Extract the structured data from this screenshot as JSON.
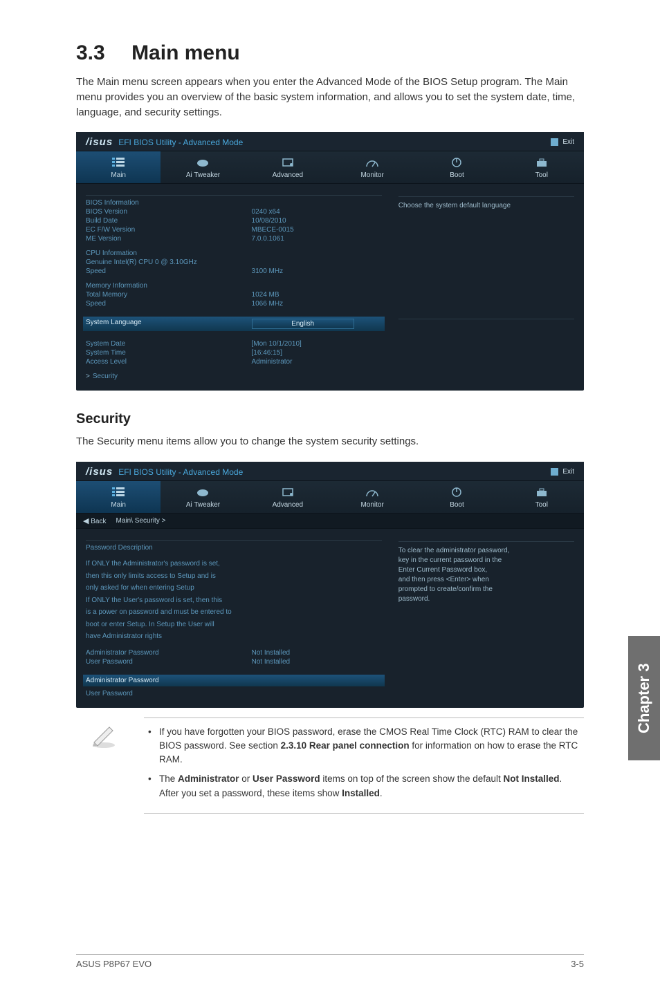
{
  "section": {
    "number": "3.3",
    "title": "Main menu"
  },
  "intro": "The Main menu screen appears when you enter the Advanced Mode of the BIOS Setup program. The Main menu provides you an overview of the basic system information, and allows you to set the system date, time, language, and security settings.",
  "bios_common": {
    "logo": "/isus",
    "utility_title": "EFI BIOS Utility - Advanced Mode",
    "exit_label": "Exit",
    "tabs": {
      "main": "Main",
      "ai_tweaker": "Ai Tweaker",
      "advanced": "Advanced",
      "monitor": "Monitor",
      "boot": "Boot",
      "tool": "Tool"
    }
  },
  "bios_main": {
    "help_text": "Choose the system default language",
    "rows": {
      "bios_information": "BIOS Information",
      "bios_version_k": "BIOS Version",
      "bios_version_v": "0240 x64",
      "build_date_k": "Build Date",
      "build_date_v": "10/08/2010",
      "ec_fw_k": "EC F/W Version",
      "ec_fw_v": "MBECE-0015",
      "me_k": "ME Version",
      "me_v": "7.0.0.1061",
      "cpu_info": "CPU Information",
      "cpu_name": "Genuine Intel(R) CPU 0 @ 3.10GHz",
      "cpu_speed_k": "Speed",
      "cpu_speed_v": "3100 MHz",
      "mem_info": "Memory Information",
      "total_mem_k": "Total Memory",
      "total_mem_v": "1024 MB",
      "mem_speed_k": "Speed",
      "mem_speed_v": "1066 MHz",
      "sys_lang_k": "System Language",
      "sys_lang_v": "English",
      "sys_date_k": "System Date",
      "sys_date_v": "[Mon 10/1/2010]",
      "sys_time_k": "System Time",
      "sys_time_v": "[16:46:15]",
      "access_k": "Access Level",
      "access_v": "Administrator",
      "security": "Security"
    }
  },
  "security_heading": "Security",
  "security_intro": "The Security menu items allow you to change the system security settings.",
  "bios_security": {
    "back_label": "Back",
    "breadcrumb": "Main\\ Security  >",
    "password_description": "Password Description",
    "desc_lines": [
      "If ONLY the Administrator's password is set,",
      "then this only limits access to Setup and is",
      "only asked for when entering Setup",
      "If ONLY the User's password is set, then this",
      "is a power on password and must be entered to",
      "boot or enter Setup. In Setup the User will",
      "have Administrator rights"
    ],
    "admin_pw_k": "Administrator Password",
    "admin_pw_v": "Not Installed",
    "user_pw_k": "User Password",
    "user_pw_v": "Not Installed",
    "admin_pw_item": "Administrator Password",
    "user_pw_item": "User Password",
    "help_lines": [
      "To clear the administrator password,",
      "key in the current password in the",
      "Enter Current Password box,",
      "and then press <Enter> when",
      "prompted to create/confirm the",
      "password."
    ]
  },
  "notes": {
    "n1_a": "If you have forgotten your BIOS password, erase the CMOS Real Time Clock (RTC) RAM to clear the BIOS password. See section ",
    "n1_b": "2.3.10 Rear panel connection",
    "n1_c": " for information on how to erase the RTC RAM.",
    "n2_a": "The ",
    "n2_b": "Administrator",
    "n2_c": " or ",
    "n2_d": "User Password",
    "n2_e": " items on top of the screen show the default ",
    "n2_f": "Not Installed",
    "n2_g": ". After you set a password, these items show ",
    "n2_h": "Installed",
    "n2_i": "."
  },
  "chapter_tab": "Chapter 3",
  "footer": {
    "left": "ASUS P8P67 EVO",
    "right": "3-5"
  }
}
